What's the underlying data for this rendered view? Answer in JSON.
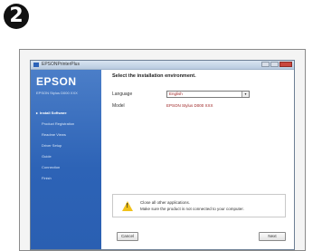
{
  "step": {
    "number": "2"
  },
  "window": {
    "title": "EPSONPrinterPlus"
  },
  "sidebar": {
    "brand": "EPSON",
    "product": "EPSON Stylus D000 XXX",
    "items": [
      {
        "label": "Install Software",
        "active": true
      },
      {
        "label": "Product Registration",
        "active": false
      },
      {
        "label": "Readme Views",
        "active": false
      },
      {
        "label": "Driver Setup",
        "active": false
      },
      {
        "label": "Guide",
        "active": false
      },
      {
        "label": "Connection",
        "active": false
      },
      {
        "label": "Finish",
        "active": false
      }
    ]
  },
  "main": {
    "heading": "Select the installation environment.",
    "language": {
      "label": "Language",
      "value": "English"
    },
    "model": {
      "label": "Model",
      "value": "EPSON Stylus D000 XXX"
    }
  },
  "warning": {
    "line1": "Close all other applications.",
    "line2": "Make sure the product is not connected to your computer."
  },
  "buttons": {
    "cancel": "Cancel",
    "next": "Next"
  },
  "colors": {
    "sidebar": "#2d63b6",
    "value_text": "#9a1b1b",
    "warning_icon": "#f1c21b"
  },
  "icons": {
    "warning": "warning-triangle-icon",
    "dropdown": "chevron-down-icon"
  }
}
